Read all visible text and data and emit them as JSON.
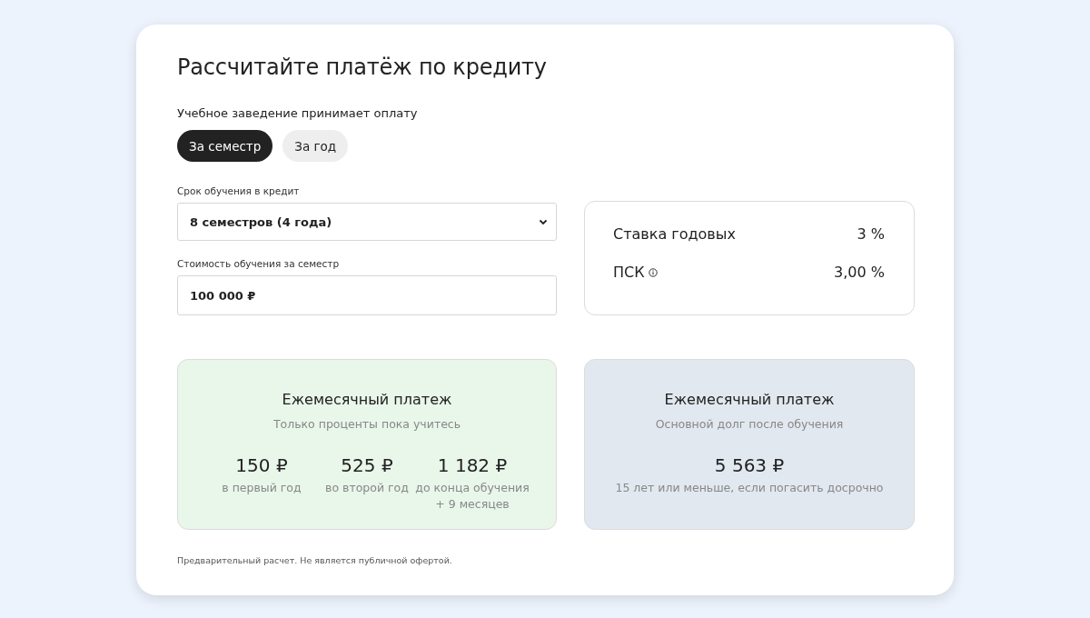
{
  "title": "Рассчитайте платёж по кредиту",
  "payment_mode": {
    "label": "Учебное заведение принимает оплату",
    "options": [
      {
        "label": "За семестр",
        "selected": true
      },
      {
        "label": "За год",
        "selected": false
      }
    ]
  },
  "fields": [
    {
      "kind": "select",
      "label": "Срок обучения в кредит",
      "value": "8 семестров (4 года)"
    },
    {
      "kind": "input",
      "label": "Стоимость обучения за семестр",
      "value": "100 000 ₽"
    }
  ],
  "rates": [
    {
      "label": "Ставка годовых",
      "info": false,
      "value": "3 %"
    },
    {
      "label": "ПСК",
      "info": true,
      "value": "3,00 %"
    }
  ],
  "payments": [
    {
      "title": "Ежемесячный платеж",
      "subtitle": "Только проценты пока учитесь",
      "color": "#e9f6ea",
      "items": [
        {
          "amount": "150 ₽",
          "caption": "в первый год"
        },
        {
          "amount": "525 ₽",
          "caption": "во второй год"
        },
        {
          "amount": "1 182 ₽",
          "caption": "до конца обучения + 9 месяцев"
        }
      ]
    },
    {
      "title": "Ежемесячный платеж",
      "subtitle": "Основной долг после обучения",
      "color": "#e2e8f0",
      "items": [
        {
          "amount": "5 563 ₽",
          "caption": "15 лет или меньше, если погасить досрочно"
        }
      ]
    }
  ],
  "disclaimer": "Предварительный расчет. Не является публичной офертой."
}
